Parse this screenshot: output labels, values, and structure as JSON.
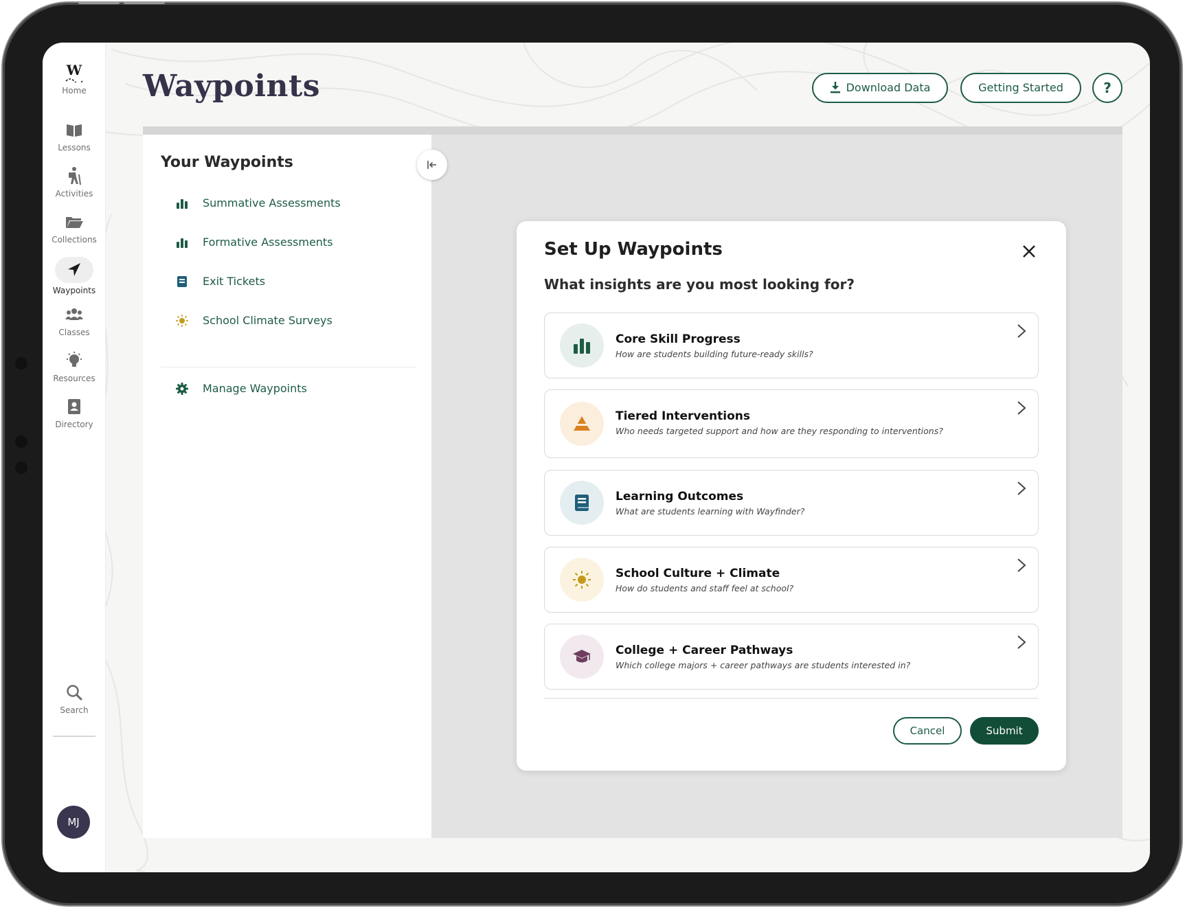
{
  "nav": {
    "items": [
      {
        "label": "Home",
        "icon": "wayfinder-logo-icon"
      },
      {
        "label": "Lessons",
        "icon": "book-icon"
      },
      {
        "label": "Activities",
        "icon": "hiker-icon"
      },
      {
        "label": "Collections",
        "icon": "folder-icon"
      },
      {
        "label": "Waypoints",
        "icon": "navigation-arrow-icon",
        "active": true
      },
      {
        "label": "Classes",
        "icon": "users-icon"
      },
      {
        "label": "Resources",
        "icon": "lightbulb-icon"
      },
      {
        "label": "Directory",
        "icon": "address-book-icon"
      },
      {
        "label": "Search",
        "icon": "search-icon"
      }
    ],
    "avatar_initials": "MJ"
  },
  "header": {
    "title": "Waypoints",
    "download_label": "Download Data",
    "getting_started_label": "Getting Started",
    "help_label": "?"
  },
  "sidebar": {
    "title": "Your Waypoints",
    "items": [
      {
        "label": "Summative Assessments",
        "icon": "bar-chart-icon"
      },
      {
        "label": "Formative Assessments",
        "icon": "bar-chart-icon"
      },
      {
        "label": "Exit Tickets",
        "icon": "notebook-icon"
      },
      {
        "label": "School Climate Surveys",
        "icon": "sun-icon"
      }
    ],
    "manage_label": "Manage Waypoints"
  },
  "modal": {
    "title": "Set Up Waypoints",
    "subtitle": "What insights are you most looking for?",
    "options": [
      {
        "title": "Core Skill Progress",
        "description": "How are students building future-ready skills?",
        "icon": "bar-chart-icon",
        "color": "#1d5c44"
      },
      {
        "title": "Tiered Interventions",
        "description": "Who needs targeted support and how are they responding to interventions?",
        "icon": "pyramid-icon",
        "color": "#d9821e"
      },
      {
        "title": "Learning Outcomes",
        "description": "What are students learning with Wayfinder?",
        "icon": "notebook-icon",
        "color": "#1f5f7a"
      },
      {
        "title": "School Culture + Climate",
        "description": "How do students and staff feel at school?",
        "icon": "sun-icon",
        "color": "#c59a1c"
      },
      {
        "title": "College + Career Pathways",
        "description": "Which college majors + career pathways are students interested in?",
        "icon": "graduation-cap-icon",
        "color": "#6e3d5f"
      }
    ],
    "cancel_label": "Cancel",
    "submit_label": "Submit"
  },
  "colors": {
    "brand_green": "#1d5c44",
    "title_ink": "#35324a"
  }
}
